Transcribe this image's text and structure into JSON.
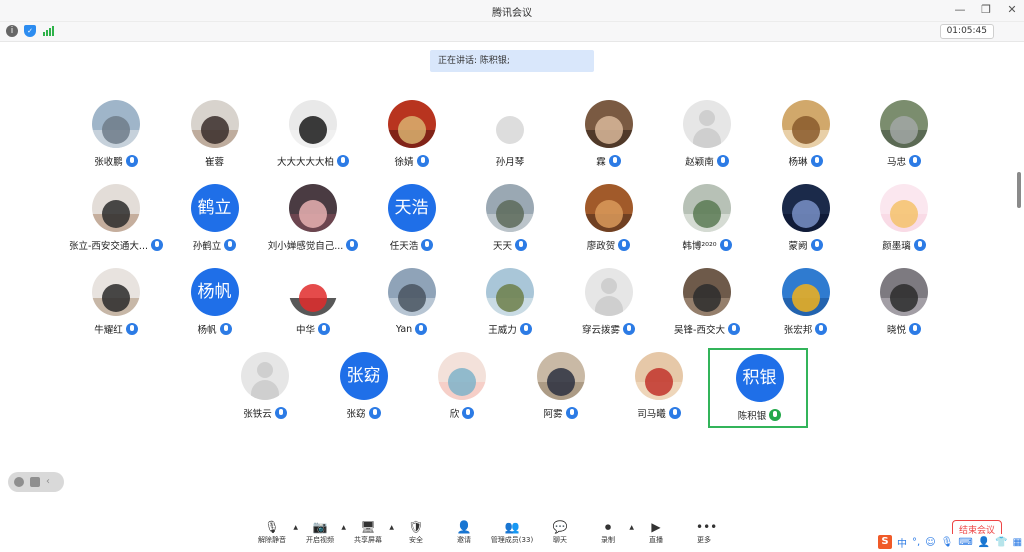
{
  "window": {
    "title": "腾讯会议",
    "controls": [
      "—",
      "❐",
      "✕"
    ]
  },
  "status": {
    "timer": "01:05:45"
  },
  "speaking": {
    "text": "正在讲话: 陈积银;"
  },
  "participants": [
    {
      "name": "张收鹏",
      "avatar": "photo",
      "colors": [
        "#9fb5c9",
        "#6f7d89",
        "#d7dde2"
      ],
      "mic": "blue"
    },
    {
      "name": "崔蓉",
      "avatar": "photo",
      "colors": [
        "#d8d3cd",
        "#3a2d2a",
        "#b49b89"
      ],
      "mic": "none"
    },
    {
      "name": "大大大大大柏",
      "avatar": "photo",
      "colors": [
        "#e9e9e9",
        "#1a1a1a",
        "#f2f2f2"
      ],
      "mic": "blue"
    },
    {
      "name": "徐婧",
      "avatar": "photo",
      "colors": [
        "#b8341f",
        "#d9b270",
        "#6a1d15"
      ],
      "mic": "blue"
    },
    {
      "name": "孙月琴",
      "avatar": "photo",
      "colors": [
        "#ffffff",
        "#d7d7d7",
        "#ffffff"
      ],
      "mic": "none"
    },
    {
      "name": "霖",
      "avatar": "photo",
      "colors": [
        "#7a5a42",
        "#d9b99a",
        "#3e2b20"
      ],
      "mic": "blue"
    },
    {
      "name": "赵颖南",
      "avatar": "placeholder",
      "mic": "blue"
    },
    {
      "name": "杨琳",
      "avatar": "photo",
      "colors": [
        "#d1a86b",
        "#8a5a2b",
        "#f2dfc0"
      ],
      "mic": "blue"
    },
    {
      "name": "马忠",
      "avatar": "photo",
      "colors": [
        "#7b8d6e",
        "#a2a7a6",
        "#4e5b48"
      ],
      "mic": "blue"
    },
    {
      "name": "张立-西安交通大...",
      "avatar": "photo",
      "colors": [
        "#e3ddd8",
        "#2b2b2b",
        "#b89a84"
      ],
      "mic": "blue"
    },
    {
      "name": "孙鹤立",
      "avatar": "text",
      "text": "鹤立",
      "mic": "blue"
    },
    {
      "name": "刘小婵感觉自己...",
      "avatar": "photo",
      "colors": [
        "#4a3b42",
        "#e7b2b2",
        "#7a4a55"
      ],
      "mic": "blue"
    },
    {
      "name": "任天浩",
      "avatar": "text",
      "text": "天浩",
      "mic": "blue"
    },
    {
      "name": "天天",
      "avatar": "photo",
      "colors": [
        "#9aa8b3",
        "#5d6b5b",
        "#c9d0d4"
      ],
      "mic": "blue"
    },
    {
      "name": "廖政贺",
      "avatar": "photo",
      "colors": [
        "#a15a2a",
        "#d99a5a",
        "#5b3420"
      ],
      "mic": "blue"
    },
    {
      "name": "韩博²⁰²⁰",
      "avatar": "photo",
      "colors": [
        "#b7c1b6",
        "#5b7a54",
        "#e1e6df"
      ],
      "mic": "blue"
    },
    {
      "name": "蒙阙",
      "avatar": "photo",
      "colors": [
        "#1b2a4a",
        "#7990c7",
        "#0c1530"
      ],
      "mic": "blue"
    },
    {
      "name": "颜墨璃",
      "avatar": "photo",
      "colors": [
        "#fbe7ef",
        "#f4c26b",
        "#f8d6e3"
      ],
      "mic": "blue"
    },
    {
      "name": "牛耀红",
      "avatar": "photo",
      "colors": [
        "#e8e3df",
        "#2a2a2a",
        "#b9a48e"
      ],
      "mic": "blue"
    },
    {
      "name": "杨帆",
      "avatar": "text",
      "text": "杨帆",
      "mic": "blue"
    },
    {
      "name": "中华",
      "avatar": "photo",
      "colors": [
        "#ffffff",
        "#e12b2b",
        "#111111"
      ],
      "mic": "blue"
    },
    {
      "name": "Yan",
      "avatar": "photo",
      "colors": [
        "#8fa3b8",
        "#4a5560",
        "#c8d3de"
      ],
      "mic": "blue"
    },
    {
      "name": "王威力",
      "avatar": "photo",
      "colors": [
        "#a9c6d8",
        "#6d7f4a",
        "#d7e4ea"
      ],
      "mic": "blue"
    },
    {
      "name": "穿云拨雾",
      "avatar": "placeholder",
      "mic": "blue"
    },
    {
      "name": "吴锋-西交大",
      "avatar": "photo",
      "colors": [
        "#6e5a4a",
        "#2d2d2d",
        "#a58e7a"
      ],
      "mic": "blue"
    },
    {
      "name": "张宏邦",
      "avatar": "photo",
      "colors": [
        "#2f7bd0",
        "#f2b21b",
        "#1e5aa0"
      ],
      "mic": "blue"
    },
    {
      "name": "晓悦",
      "avatar": "photo",
      "colors": [
        "#7d7a80",
        "#2c2c2c",
        "#b2aeb5"
      ],
      "mic": "blue"
    },
    {
      "name": "张铁云",
      "avatar": "placeholder",
      "mic": "blue"
    },
    {
      "name": "张窈",
      "avatar": "text",
      "text": "张窈",
      "mic": "blue"
    },
    {
      "name": "欣",
      "avatar": "photo",
      "colors": [
        "#f3e1da",
        "#7fb3c9",
        "#f6c7c0"
      ],
      "mic": "blue"
    },
    {
      "name": "阿雾",
      "avatar": "photo",
      "colors": [
        "#c9b9a5",
        "#2b3040",
        "#9f8e77"
      ],
      "mic": "blue"
    },
    {
      "name": "司马曦",
      "avatar": "photo",
      "colors": [
        "#e6c8a8",
        "#c1342c",
        "#f1dbc2"
      ],
      "mic": "blue"
    },
    {
      "name": "陈积银",
      "avatar": "text",
      "text": "积银",
      "mic": "green",
      "active": true
    }
  ],
  "bottombar": [
    {
      "label": "解除静音",
      "icon": "🎙",
      "caret": true
    },
    {
      "label": "开启视频",
      "icon": "📷",
      "caret": true
    },
    {
      "label": "共享屏幕",
      "icon": "🖥",
      "caret": true
    },
    {
      "label": "安全",
      "icon": "🛡",
      "caret": false
    },
    {
      "label": "邀请",
      "icon": "👤",
      "caret": false
    },
    {
      "label": "管理成员(33)",
      "icon": "👥",
      "caret": false
    },
    {
      "label": "聊天",
      "icon": "💬",
      "caret": false
    },
    {
      "label": "录制",
      "icon": "⏺",
      "caret": true
    },
    {
      "label": "直播",
      "icon": "▶",
      "caret": false
    },
    {
      "label": "更多",
      "icon": "•••",
      "caret": false
    }
  ],
  "end_button": "结束会议",
  "ime": {
    "logo": "S",
    "lang": "中"
  }
}
